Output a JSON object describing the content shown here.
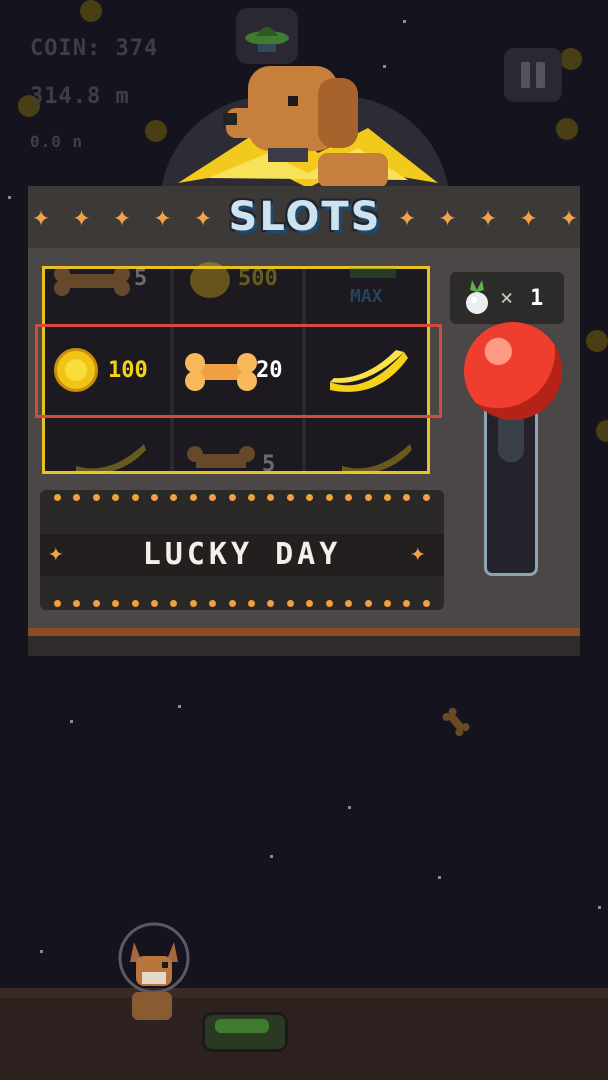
{
  "hud": {
    "coin": "COIN: 374",
    "distance": "314.8 m",
    "speed": "0.0 n"
  },
  "machine": {
    "title": "SLOTS"
  },
  "reels": {
    "top_row": {
      "bone_value": "5",
      "coin_value": "500",
      "max_label": "MAX"
    },
    "win_row": {
      "coin_value": "100",
      "bone_value": "20"
    },
    "bottom_row": {
      "bone_value": "5"
    }
  },
  "lucky_banner": {
    "text": "LUCKY DAY"
  },
  "spin_counter": {
    "multiplier": "×",
    "count": "1"
  },
  "colors": {
    "background": "#15131d",
    "reel_border": "#e6c324",
    "win_highlight": "#d34b3a",
    "lever_knob": "#ef3e2e",
    "accent_orange": "#f3a04b"
  },
  "icons": {
    "win_row": [
      "coin-icon",
      "bone-icon",
      "banana-icon"
    ],
    "top_row": [
      "bone-icon",
      "coin-icon",
      "max-icon"
    ],
    "bottom_row": [
      "banana-icon",
      "bone-icon",
      "banana-icon"
    ]
  }
}
